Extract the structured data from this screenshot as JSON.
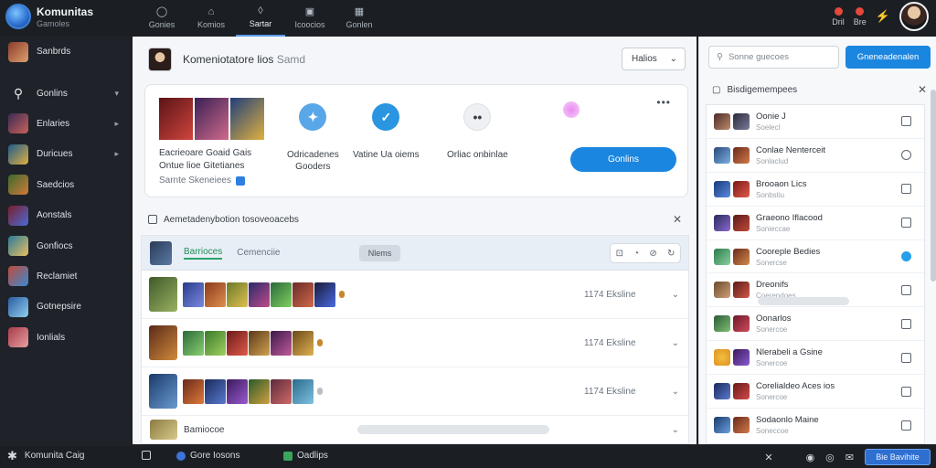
{
  "app": {
    "name": "Komunitas",
    "subtitle": "Gamoles"
  },
  "topnav": [
    {
      "label": "Gonies",
      "icon": "controller-icon"
    },
    {
      "label": "Komios",
      "icon": "home-icon"
    },
    {
      "label": "Sartar",
      "icon": "shield-icon"
    },
    {
      "label": "Icoocios",
      "icon": "store-icon"
    },
    {
      "label": "Gonlen",
      "icon": "grid-icon"
    }
  ],
  "topright": {
    "item1": "Dril",
    "item2": "Bre"
  },
  "sidebar": {
    "items": [
      {
        "label": "Sanbrds"
      },
      {
        "label": "Gonlins"
      },
      {
        "label": "Enlaries"
      },
      {
        "label": "Duricues"
      },
      {
        "label": "Saedcios"
      },
      {
        "label": "Aonstals"
      },
      {
        "label": "Gonfiocs"
      },
      {
        "label": "Reclamiet"
      },
      {
        "label": "Gotnepsire"
      },
      {
        "label": "Ionlials"
      }
    ]
  },
  "main": {
    "header_title": "Komeniotatore lios",
    "header_title_muted": "Samd",
    "select_label": "Halios",
    "card": {
      "label_line1": "Eacrieoare Goaid Gais",
      "label_line2": "Ontue lioe Gitetianes",
      "label_sub": "Sarnte Skeneiees",
      "features": [
        {
          "label": "Odricadenes",
          "label2": "Gooders"
        },
        {
          "label": "Vatine Ua oiems",
          "label2": ""
        },
        {
          "label": "Orliac onbinlae",
          "label2": ""
        }
      ],
      "join_label": "Gonlins"
    },
    "section_title": "Aemetadenybotion tosoveoacebs",
    "list": {
      "tab1": "Barrioces",
      "tab2": "Cemenciie",
      "chip": "Nlems",
      "rows": [
        {
          "time": "1174 Eksline"
        },
        {
          "time": "1174 Eksline"
        },
        {
          "time": "1174 Eksline"
        }
      ],
      "last_label": "Bamiocoe"
    }
  },
  "rpanel": {
    "search_placeholder": "Sonne guecoes",
    "button_label": "Gneneadenalen",
    "header": "Bisdigemempees",
    "items": [
      {
        "name": "Oonie J",
        "sub": "Soelecl"
      },
      {
        "name": "Conlae Nenterceit",
        "sub": "Sonlaclud"
      },
      {
        "name": "Brooaon Lics",
        "sub": "Sonbstiu"
      },
      {
        "name": "Graeono Iflacood",
        "sub": "Sonieccae"
      },
      {
        "name": "Cooreple Bedies",
        "sub": "Sonercse"
      },
      {
        "name": "Dreonifs",
        "sub": "Coerendoes"
      },
      {
        "name": "Oonarlos",
        "sub": "Sonercoe"
      },
      {
        "name": "Nlerabeli a Gsine",
        "sub": "Sonercoe"
      },
      {
        "name": "Corelialdeo Aces ios",
        "sub": "Sonercoe"
      },
      {
        "name": "Sodaonlo Maine",
        "sub": "Soneccoe"
      }
    ]
  },
  "bottombar": {
    "left_label": "Komunita Caig",
    "item1": "Gore Iosons",
    "item2": "Oadlips",
    "button_label": "Bie Bavihite"
  },
  "colors": {
    "accent": "#1b86e0",
    "success": "#2aa36a",
    "dark_bg": "#1b1f24",
    "notification": "#e5483c"
  }
}
